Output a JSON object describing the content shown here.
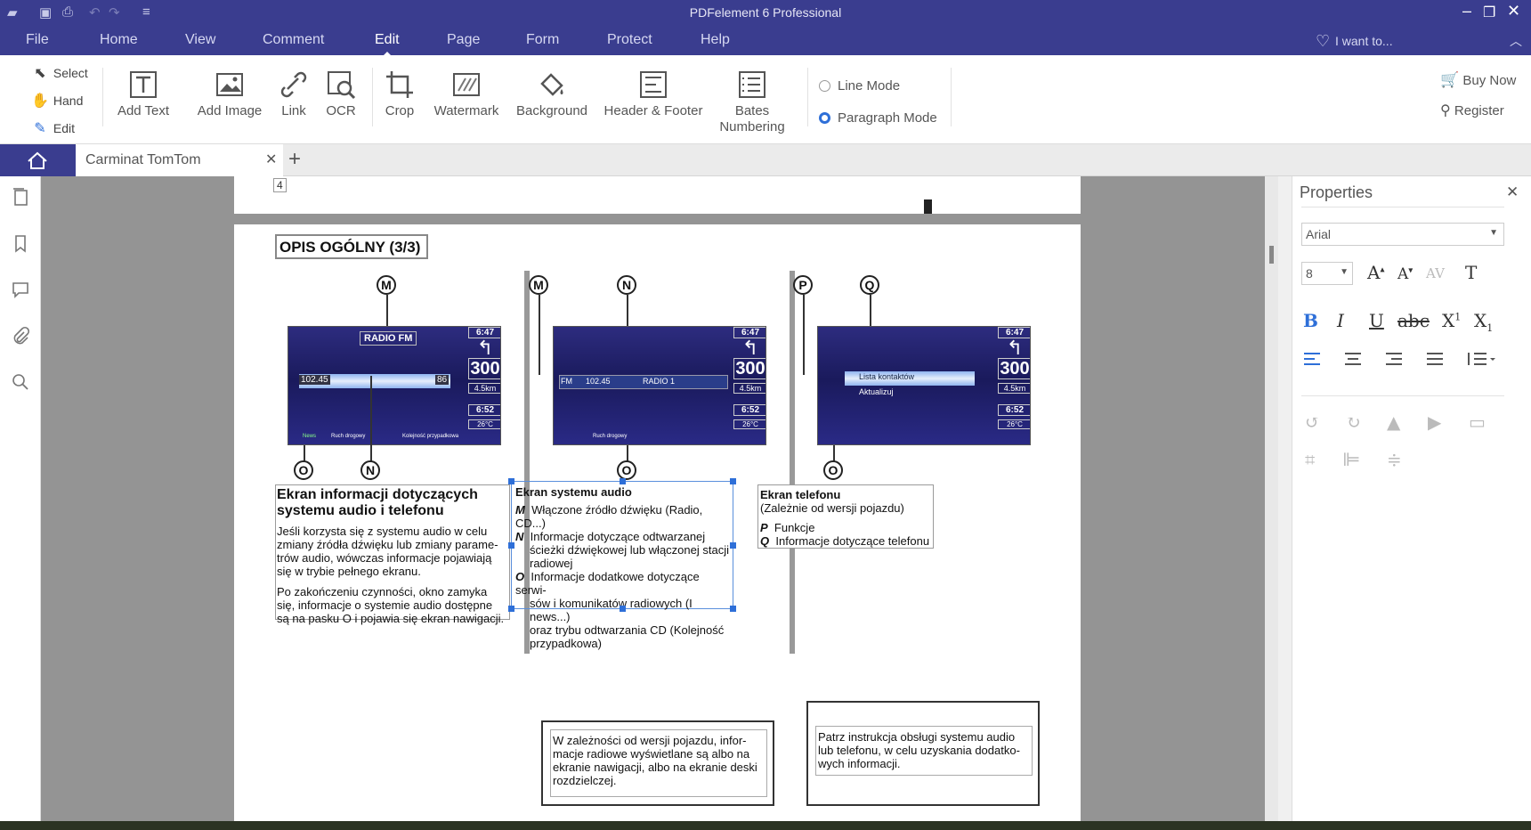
{
  "window": {
    "title": "PDFelement 6 Professional"
  },
  "menu": {
    "items": [
      "File",
      "Home",
      "View",
      "Comment",
      "Edit",
      "Page",
      "Form",
      "Protect",
      "Help"
    ],
    "active": "Edit",
    "want_to": "I want to..."
  },
  "ribbon": {
    "select": "Select",
    "hand": "Hand",
    "edit": "Edit",
    "add_text": "Add Text",
    "add_image": "Add Image",
    "link": "Link",
    "ocr": "OCR",
    "crop": "Crop",
    "watermark": "Watermark",
    "background": "Background",
    "header_footer": "Header & Footer",
    "bates_1": "Bates",
    "bates_2": "Numbering",
    "line_mode": "Line Mode",
    "paragraph_mode": "Paragraph Mode",
    "mode_selected": "Paragraph Mode",
    "buy_now": "Buy Now",
    "register": "Register"
  },
  "tabs": {
    "doc_title": "Carminat TomTom"
  },
  "properties": {
    "title": "Properties",
    "font": "Arial",
    "size": "8",
    "btn_bold": "B",
    "btn_italic": "I",
    "btn_underline": "U",
    "btn_strike": "abc",
    "btn_super": "X",
    "btn_sub": "X",
    "btn_sup_mark": "1",
    "btn_sub_mark": "1"
  },
  "document": {
    "prev_page_number": "4",
    "heading": "OPIS OGÓLNY (3/3)",
    "col1": {
      "screen_title": "RADIO FM",
      "freq": "102.45",
      "freq_right": "86",
      "footer_1": "News",
      "footer_2": "Ruch drogowy",
      "footer_3": "Kolejność przypadkowa",
      "title_1": "Ekran informacji dotyczących",
      "title_2": "systemu audio i telefonu",
      "body_1": [
        "Jeśli korzysta się z systemu audio w celu",
        "zmiany źródła dźwięku lub zmiany parame-",
        "trów audio, wówczas informacje pojawiają",
        "się w trybie pełnego ekranu."
      ],
      "body_2": [
        "Po zakończeniu czynności, okno zamyka",
        "się, informacje o systemie audio dostępne",
        "są na pasku O i pojawia się ekran nawigacji."
      ]
    },
    "col2": {
      "fm": "FM",
      "freq": "102.45",
      "station": "RADIO 1",
      "footer": "Ruch drogowy",
      "title": "Ekran systemu audio",
      "items": [
        {
          "letter": "M",
          "lines": [
            "Włączone źródło dźwięku (Radio, CD...)"
          ]
        },
        {
          "letter": "N",
          "lines": [
            "Informacje dotyczące odtwarzanej",
            "ścieżki dźwiękowej lub włączonej stacji",
            "radiowej"
          ]
        },
        {
          "letter": "O",
          "lines": [
            "Informacje dodatkowe dotyczące serwi-",
            "sów i komunikatów radiowych (I news...)",
            "oraz trybu odtwarzania CD (Kolejność",
            "przypadkowa)"
          ]
        }
      ],
      "note": [
        "W zależności od wersji pojazdu, infor-",
        "macje radiowe wyświetlane są albo na",
        "ekranie nawigacji, albo na ekranie deski",
        "rozdzielczej."
      ]
    },
    "col3": {
      "menu_1": "Lista kontaktów",
      "menu_2": "Aktualizuj",
      "title": "Ekran telefonu",
      "subtitle": "(Zależnie od wersji pojazdu)",
      "items": [
        {
          "letter": "P",
          "text": "Funkcje"
        },
        {
          "letter": "Q",
          "text": "Informacje dotyczące telefonu"
        }
      ],
      "note": [
        "Patrz instrukcja obsługi systemu audio",
        "lub telefonu, w celu uzyskania dodatko-",
        "wych informacji."
      ]
    },
    "nav_panel": {
      "time_1": "6:47",
      "distance": "300",
      "unit": "metres",
      "dist2": "4.5km",
      "time_2": "6:52",
      "temp": "26°C"
    },
    "callouts": {
      "m": "M",
      "n": "N",
      "o": "O",
      "p": "P",
      "q": "Q"
    }
  }
}
